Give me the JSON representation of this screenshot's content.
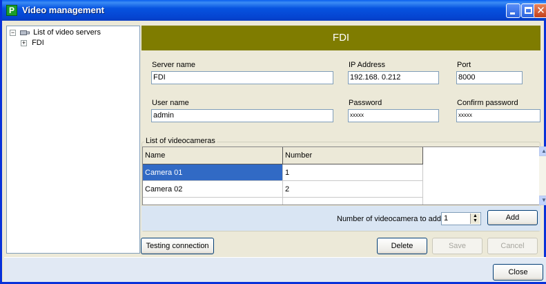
{
  "window": {
    "title": "Video management",
    "app_icon_letter": "P"
  },
  "tree": {
    "root_label": "List of video servers",
    "root_toggle": "−",
    "child_label": "FDI",
    "child_toggle": "+"
  },
  "server": {
    "header": "FDI",
    "server_name_label": "Server name",
    "server_name_value": "FDI",
    "ip_label": "IP Address",
    "ip_value": "192.168.  0.212",
    "port_label": "Port",
    "port_value": "8000",
    "user_label": "User name",
    "user_value": "admin",
    "password_label": "Password",
    "password_value": "xxxxx",
    "confirm_label": "Confirm password",
    "confirm_value": "xxxxx"
  },
  "cameras": {
    "group_label": "List of videocameras",
    "columns": [
      "Name",
      "Number"
    ],
    "rows": [
      {
        "name": "Camera 01",
        "number": "1"
      },
      {
        "name": "Camera 02",
        "number": "2"
      }
    ],
    "add_label": "Number of videocamera to add",
    "add_value": "1",
    "add_button": "Add"
  },
  "actions": {
    "testing": "Testing connection",
    "delete": "Delete",
    "save": "Save",
    "cancel": "Cancel",
    "close": "Close"
  },
  "colors": {
    "header_band": "#7f7c00",
    "selection": "#316ac5",
    "title_bar": "#0653e0"
  }
}
